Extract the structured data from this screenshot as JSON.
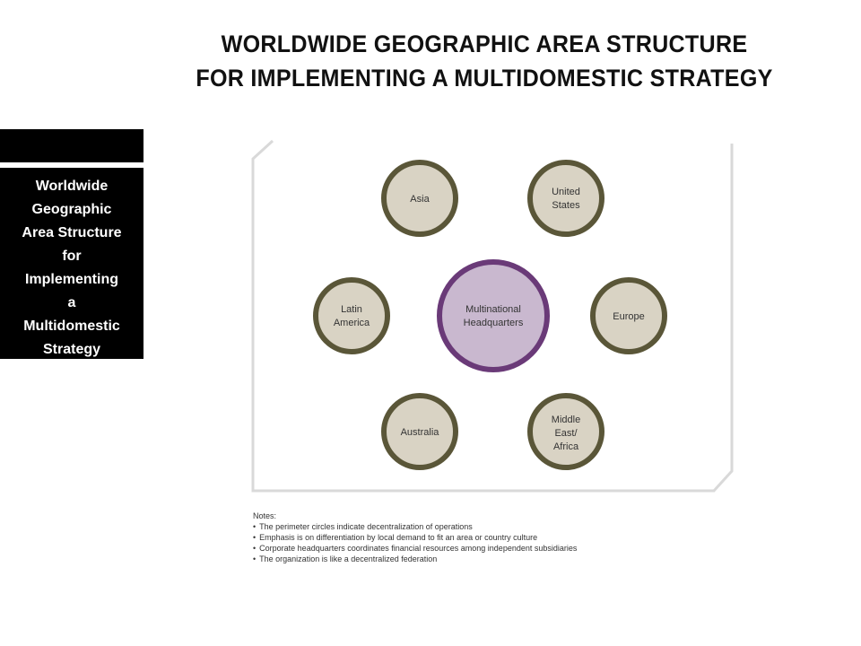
{
  "title": {
    "line1": "WORLDWIDE GEOGRAPHIC AREA STRUCTURE",
    "line2": "FOR IMPLEMENTING A MULTIDOMESTIC STRATEGY"
  },
  "sidebar": {
    "lines": [
      "Worldwide",
      "Geographic",
      "Area Structure",
      "for",
      "Implementing",
      "a",
      "Multidomestic",
      "Strategy"
    ]
  },
  "diagram": {
    "center": {
      "line1": "Multinational",
      "line2": "Headquarters"
    },
    "nodes": [
      {
        "line1": "Asia",
        "line2": "",
        "line3": ""
      },
      {
        "line1": "United",
        "line2": "States",
        "line3": ""
      },
      {
        "line1": "Latin",
        "line2": "America",
        "line3": ""
      },
      {
        "line1": "Europe",
        "line2": "",
        "line3": ""
      },
      {
        "line1": "Australia",
        "line2": "",
        "line3": ""
      },
      {
        "line1": "Middle",
        "line2": "East/",
        "line3": "Africa"
      }
    ],
    "colors": {
      "node_fill": "#d9d3c4",
      "node_ring": "#5a5638",
      "center_fill": "#c9b8cf",
      "center_ring": "#6a3a78",
      "frame": "#d9d9d9"
    }
  },
  "notes": {
    "heading": "Notes:",
    "items": [
      "The perimeter circles indicate decentralization of operations",
      "Emphasis is on differentiation by local demand to fit an area or country culture",
      "Corporate headquarters coordinates financial resources among independent subsidiaries",
      "The organization is like a decentralized federation"
    ]
  }
}
